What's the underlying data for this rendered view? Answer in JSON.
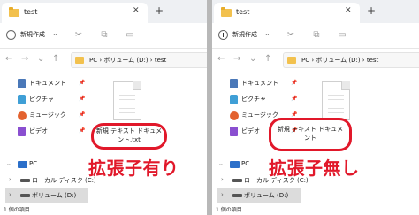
{
  "left": {
    "tab_title": "test",
    "tab_close": "✕",
    "tab_add": "+",
    "new_button": "新規作成",
    "new_chevron": "⌄",
    "breadcrumb": "PC  ›  ボリューム (D:)  ›  test",
    "sidebar": [
      {
        "label": "ドキュメント",
        "icon": "document-icon"
      },
      {
        "label": "ピクチャ",
        "icon": "picture-icon"
      },
      {
        "label": "ミュージック",
        "icon": "music-icon"
      },
      {
        "label": "ビデオ",
        "icon": "video-icon"
      }
    ],
    "pc_label": "PC",
    "drives": [
      "ローカル ディスク (C:)",
      "ボリューム (D:)"
    ],
    "file_name": "新規 テキスト ドキュメント.txt",
    "caption": "拡張子有り",
    "status": "1 個の項目"
  },
  "right": {
    "tab_title": "test",
    "tab_close": "✕",
    "tab_add": "+",
    "new_button": "新規作成",
    "new_chevron": "⌄",
    "breadcrumb": "PC  ›  ボリューム (D:)  ›  test",
    "sidebar": [
      {
        "label": "ドキュメント",
        "icon": "document-icon"
      },
      {
        "label": "ピクチャ",
        "icon": "picture-icon"
      },
      {
        "label": "ミュージック",
        "icon": "music-icon"
      },
      {
        "label": "ビデオ",
        "icon": "video-icon"
      }
    ],
    "pc_label": "PC",
    "drives": [
      "ローカル ディスク (C:)",
      "ボリューム (D:)"
    ],
    "file_name": "新規 テキスト ドキュメント",
    "caption": "拡張子無し",
    "status": "1 個の項目"
  },
  "colors": {
    "accent_red": "#e1182a",
    "folder_yellow": "#f2c14e",
    "selection_gray": "#dcdcdc"
  },
  "icons": {
    "cut": "✂",
    "copy": "⧉",
    "paste": "▭",
    "back": "←",
    "forward": "→",
    "down": "⌄",
    "up": "↑",
    "pin": "📌",
    "chevron_right": "›",
    "chevron_down": "⌄"
  }
}
